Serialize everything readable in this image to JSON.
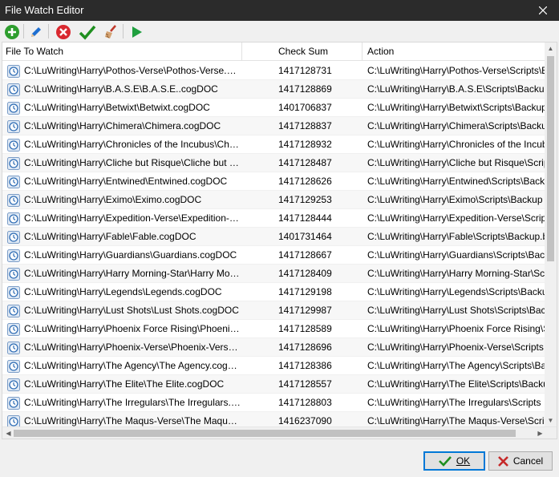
{
  "window": {
    "title": "File Watch Editor"
  },
  "toolbar": {
    "buttons": [
      {
        "name": "add",
        "icon": "plus-circle-icon",
        "color": "#2e9e2e"
      },
      {
        "name": "edit",
        "icon": "pencil-icon",
        "color": "#1e6fd0"
      },
      {
        "name": "delete",
        "icon": "x-circle-icon",
        "color": "#d9282f"
      },
      {
        "name": "accept",
        "icon": "checkmark-icon",
        "color": "#1f8f1f"
      },
      {
        "name": "clear",
        "icon": "broom-icon",
        "color": "#c0392b"
      },
      {
        "name": "run",
        "icon": "play-icon",
        "color": "#1f9f3f"
      }
    ]
  },
  "table": {
    "columns": [
      "File To Watch",
      "Check Sum",
      "Action"
    ],
    "rows": [
      {
        "file": "C:\\LuWriting\\Harry\\Pothos-Verse\\Pothos-Verse.cogDOC",
        "sum": "1417128731",
        "action": "C:\\LuWriting\\Harry\\Pothos-Verse\\Scripts\\Backup"
      },
      {
        "file": "C:\\LuWriting\\Harry\\B.A.S.E\\B.A.S.E..cogDOC",
        "sum": "1417128869",
        "action": "C:\\LuWriting\\Harry\\B.A.S.E\\Scripts\\Backup"
      },
      {
        "file": "C:\\LuWriting\\Harry\\Betwixt\\Betwixt.cogDOC",
        "sum": "1401706837",
        "action": "C:\\LuWriting\\Harry\\Betwixt\\Scripts\\Backup"
      },
      {
        "file": "C:\\LuWriting\\Harry\\Chimera\\Chimera.cogDOC",
        "sum": "1417128837",
        "action": "C:\\LuWriting\\Harry\\Chimera\\Scripts\\Backup"
      },
      {
        "file": "C:\\LuWriting\\Harry\\Chronicles of the Incubus\\Chronicles of the Incubus.cogDOC",
        "sum": "1417128932",
        "action": "C:\\LuWriting\\Harry\\Chronicles of the Incubus"
      },
      {
        "file": "C:\\LuWriting\\Harry\\Cliche but Risque\\Cliche but Risque.cogDOC",
        "sum": "1417128487",
        "action": "C:\\LuWriting\\Harry\\Cliche but Risque\\Scripts"
      },
      {
        "file": "C:\\LuWriting\\Harry\\Entwined\\Entwined.cogDOC",
        "sum": "1417128626",
        "action": "C:\\LuWriting\\Harry\\Entwined\\Scripts\\Backup"
      },
      {
        "file": "C:\\LuWriting\\Harry\\Eximo\\Eximo.cogDOC",
        "sum": "1417129253",
        "action": "C:\\LuWriting\\Harry\\Eximo\\Scripts\\Backup"
      },
      {
        "file": "C:\\LuWriting\\Harry\\Expedition-Verse\\Expedition-Verse.cogDOC",
        "sum": "1417128444",
        "action": "C:\\LuWriting\\Harry\\Expedition-Verse\\Scripts"
      },
      {
        "file": "C:\\LuWriting\\Harry\\Fable\\Fable.cogDOC",
        "sum": "1401731464",
        "action": "C:\\LuWriting\\Harry\\Fable\\Scripts\\Backup.bat"
      },
      {
        "file": "C:\\LuWriting\\Harry\\Guardians\\Guardians.cogDOC",
        "sum": "1417128667",
        "action": "C:\\LuWriting\\Harry\\Guardians\\Scripts\\Backup"
      },
      {
        "file": "C:\\LuWriting\\Harry\\Harry Morning-Star\\Harry Morning-Star.cogDOC",
        "sum": "1417128409",
        "action": "C:\\LuWriting\\Harry\\Harry Morning-Star\\Scripts"
      },
      {
        "file": "C:\\LuWriting\\Harry\\Legends\\Legends.cogDOC",
        "sum": "1417129198",
        "action": "C:\\LuWriting\\Harry\\Legends\\Scripts\\Backup"
      },
      {
        "file": "C:\\LuWriting\\Harry\\Lust Shots\\Lust Shots.cogDOC",
        "sum": "1417129987",
        "action": "C:\\LuWriting\\Harry\\Lust Shots\\Scripts\\Backup"
      },
      {
        "file": "C:\\LuWriting\\Harry\\Phoenix Force Rising\\Phoenix Force Rising.cogDOC",
        "sum": "1417128589",
        "action": "C:\\LuWriting\\Harry\\Phoenix Force Rising\\Scripts"
      },
      {
        "file": "C:\\LuWriting\\Harry\\Phoenix-Verse\\Phoenix-Verse.cogDOC",
        "sum": "1417128696",
        "action": "C:\\LuWriting\\Harry\\Phoenix-Verse\\Scripts"
      },
      {
        "file": "C:\\LuWriting\\Harry\\The Agency\\The Agency.cogDOC",
        "sum": "1417128386",
        "action": "C:\\LuWriting\\Harry\\The Agency\\Scripts\\Backup"
      },
      {
        "file": "C:\\LuWriting\\Harry\\The Elite\\The Elite.cogDOC",
        "sum": "1417128557",
        "action": "C:\\LuWriting\\Harry\\The Elite\\Scripts\\Backup"
      },
      {
        "file": "C:\\LuWriting\\Harry\\The Irregulars\\The Irregulars.cogDOC",
        "sum": "1417128803",
        "action": "C:\\LuWriting\\Harry\\The Irregulars\\Scripts"
      },
      {
        "file": "C:\\LuWriting\\Harry\\The Maqus-Verse\\The Maqus-Verse.cogDOC",
        "sum": "1416237090",
        "action": "C:\\LuWriting\\Harry\\The Maqus-Verse\\Scripts"
      }
    ]
  },
  "footer": {
    "ok_label": "OK",
    "cancel_label": "Cancel",
    "ok_accent": "#0078d7"
  }
}
